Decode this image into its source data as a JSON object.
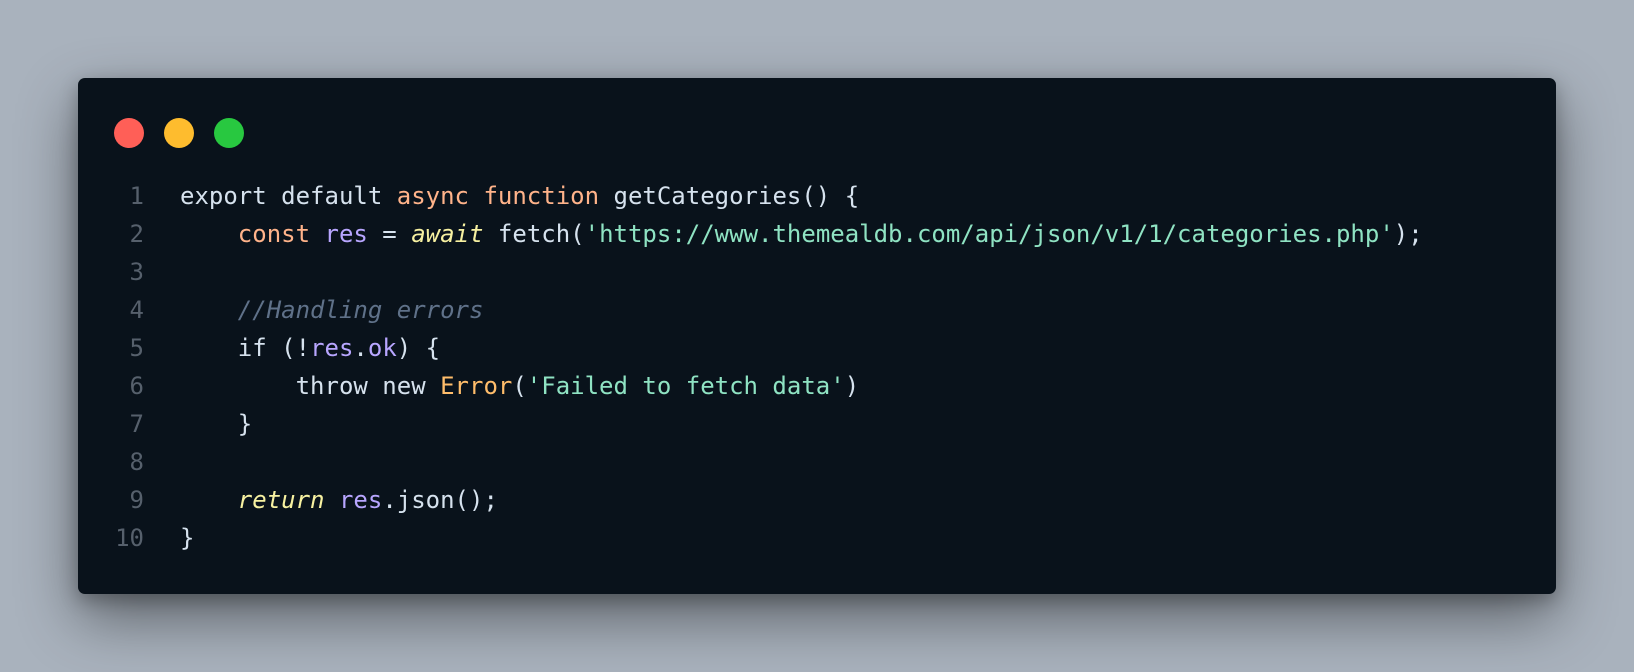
{
  "colors": {
    "background": "#a9b2bd",
    "window_bg": "#09121b",
    "line_number": "#56606c",
    "dot_close": "#ff5f57",
    "dot_minimize": "#febc2e",
    "dot_zoom": "#28c840"
  },
  "window": {
    "controls": [
      {
        "name": "close",
        "color": "#ff5f57"
      },
      {
        "name": "minimize",
        "color": "#febc2e"
      },
      {
        "name": "zoom",
        "color": "#28c840"
      }
    ]
  },
  "code": {
    "language": "javascript",
    "lines": [
      {
        "number": "1",
        "tokens": [
          {
            "text": "export ",
            "color": "#d6e2ee"
          },
          {
            "text": "default ",
            "color": "#d6e2ee"
          },
          {
            "text": "async ",
            "color": "#ffb38a"
          },
          {
            "text": "function ",
            "color": "#ffb38a"
          },
          {
            "text": "getCategories",
            "color": "#d6e2ee"
          },
          {
            "text": "() {",
            "color": "#d6e2ee"
          }
        ]
      },
      {
        "number": "2",
        "tokens": [
          {
            "text": "    ",
            "color": "#d6e2ee"
          },
          {
            "text": "const ",
            "color": "#ffb38a"
          },
          {
            "text": "res",
            "color": "#b8a6ff"
          },
          {
            "text": " = ",
            "color": "#d6e2ee"
          },
          {
            "text": "await",
            "color": "#f7f1a1",
            "italic": true
          },
          {
            "text": " fetch(",
            "color": "#d6e2ee"
          },
          {
            "text": "'https://www.themealdb.com/api/json/v1/1/categories.php'",
            "color": "#8fe3c3"
          },
          {
            "text": ");",
            "color": "#d6e2ee"
          }
        ]
      },
      {
        "number": "3",
        "tokens": []
      },
      {
        "number": "4",
        "tokens": [
          {
            "text": "    ",
            "color": "#d6e2ee"
          },
          {
            "text": "//Handling errors",
            "color": "#5f7189",
            "italic": true
          }
        ]
      },
      {
        "number": "5",
        "tokens": [
          {
            "text": "    ",
            "color": "#d6e2ee"
          },
          {
            "text": "if",
            "color": "#d6e2ee"
          },
          {
            "text": " (!",
            "color": "#d6e2ee"
          },
          {
            "text": "res",
            "color": "#b8a6ff"
          },
          {
            "text": ".",
            "color": "#d6e2ee"
          },
          {
            "text": "ok",
            "color": "#b8a6ff"
          },
          {
            "text": ") {",
            "color": "#d6e2ee"
          }
        ]
      },
      {
        "number": "6",
        "tokens": [
          {
            "text": "        ",
            "color": "#d6e2ee"
          },
          {
            "text": "throw ",
            "color": "#d6e2ee"
          },
          {
            "text": "new ",
            "color": "#d6e2ee"
          },
          {
            "text": "Error",
            "color": "#ffbd6b"
          },
          {
            "text": "(",
            "color": "#d6e2ee"
          },
          {
            "text": "'Failed to fetch data'",
            "color": "#8fe3c3"
          },
          {
            "text": ")",
            "color": "#d6e2ee"
          }
        ]
      },
      {
        "number": "7",
        "tokens": [
          {
            "text": "    }",
            "color": "#d6e2ee"
          }
        ]
      },
      {
        "number": "8",
        "tokens": []
      },
      {
        "number": "9",
        "tokens": [
          {
            "text": "    ",
            "color": "#d6e2ee"
          },
          {
            "text": "return",
            "color": "#f7f1a1",
            "italic": true
          },
          {
            "text": " ",
            "color": "#d6e2ee"
          },
          {
            "text": "res",
            "color": "#b8a6ff"
          },
          {
            "text": ".json();",
            "color": "#d6e2ee"
          }
        ]
      },
      {
        "number": "10",
        "tokens": [
          {
            "text": "}",
            "color": "#d6e2ee"
          }
        ]
      }
    ]
  }
}
